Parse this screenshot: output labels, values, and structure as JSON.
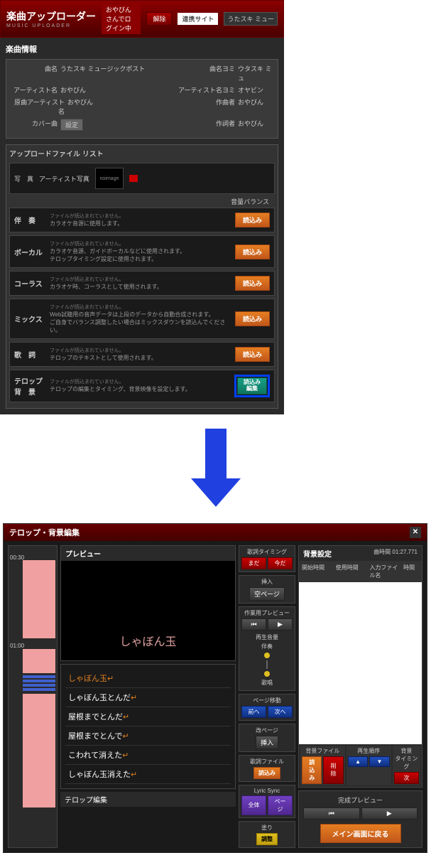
{
  "header": {
    "title": "楽曲アップローダー",
    "subtitle": "MUSIC UPLOADER",
    "login_status": "おやびんさんでログイン中",
    "logout_btn": "解除",
    "link_label": "連携サイト",
    "dropdown": "うたスキ ミュー"
  },
  "song_info": {
    "title": "楽曲情報",
    "labels": {
      "song_name": "曲名",
      "song_yomi": "曲名ヨミ",
      "artist": "アーティスト名",
      "artist_yomi": "アーティスト名ヨミ",
      "orig_artist": "原曲アーティスト名",
      "composer": "作曲者",
      "cover": "カバー曲",
      "lyricist": "作詞者"
    },
    "values": {
      "song_name": "うたスキ ミュージックポスト",
      "song_yomi": "ウタスキ ミュ",
      "artist": "おやびん",
      "artist_yomi": "オヤビン",
      "orig_artist": "おやびん",
      "composer": "おやびん",
      "lyricist": "おやびん"
    },
    "set_btn": "設定"
  },
  "upload": {
    "title": "アップロードファイル リスト",
    "photo_label": "写　真",
    "artist_photo": "アーティスト写真",
    "noimage": "noimage",
    "balance": "音量バランス",
    "load_btn": "読込み",
    "load_edit_btn": "読込み\n編集",
    "tracks": [
      {
        "name": "伴　奏",
        "d1": "ファイルが読込まれていません。",
        "d2": "カラオケ音源に使用します。"
      },
      {
        "name": "ボーカル",
        "d1": "ファイルが読込まれていません。",
        "d2": "カラオケ音源、ガイドボーカルなどに使用されます。\nテロップタイミング設定に使用されます。"
      },
      {
        "name": "コーラス",
        "d1": "ファイルが読込まれていません。",
        "d2": "カラオケ時、コーラスとして使用されます。"
      },
      {
        "name": "ミックス",
        "d1": "ファイルが読込まれていません。",
        "d2": "Web試聴用の音声データは上段のデータから自動合成されます。\nご自身でバランス調整したい場合はミックスダウンを読込んでください。"
      },
      {
        "name": "歌　詞",
        "d1": "ファイルが読込まれていません。",
        "d2": "テロップのテキストとして使用されます。"
      },
      {
        "name": "テロップ\n背　景",
        "d1": "ファイルが読込まれていません。",
        "d2": "テロップの編集とタイミング、背景映像を設定します。"
      }
    ]
  },
  "editor": {
    "title": "テロップ・背景編集",
    "timeline": {
      "m0030": "00:30",
      "m0100": "01:00"
    },
    "preview": {
      "title": "プレビュー",
      "text": "しゃぼん玉"
    },
    "lyrics": [
      "しゃぼん玉",
      "しゃぼん玉とんだ",
      "屋根までとんだ",
      "屋根までとんで",
      "こわれて消えた",
      "しゃぼん玉消えた"
    ],
    "telop_edit": "テロップ編集",
    "controls": {
      "timing_label": "歌詞タイミング",
      "mada": "まだ",
      "ima": "今だ",
      "insert_label": "挿入",
      "blank_page": "空ページ",
      "work_preview": "作業用プレビュー",
      "play_vol": "再生音量",
      "banso": "伴奏",
      "uta": "歌唱",
      "page_move": "ページ移動",
      "prev": "前へ",
      "next": "次へ",
      "newpage_label": "改ページ",
      "insert": "挿入",
      "lyric_file": "歌詞ファイル",
      "read": "読込み",
      "lyric_sync": "Lyric Sync",
      "all": "全体",
      "page": "ページ",
      "nuri": "塗り",
      "adjust": "調整"
    },
    "bg": {
      "title": "背景設定",
      "time_label": "曲時間",
      "time_val": "01:27.771",
      "cols": {
        "start": "開始時間",
        "use": "使用時間",
        "file": "入力ファイル名",
        "time": "時間"
      },
      "bg_file": "背景ファイル",
      "play_order": "再生順序",
      "bg_timing": "背景\nタイミング",
      "read": "読込み",
      "delete": "削除",
      "up": "▲",
      "down": "▼",
      "next": "次"
    },
    "complete": {
      "title": "完成プレビュー",
      "back_btn": "メイン画面に戻る"
    }
  }
}
